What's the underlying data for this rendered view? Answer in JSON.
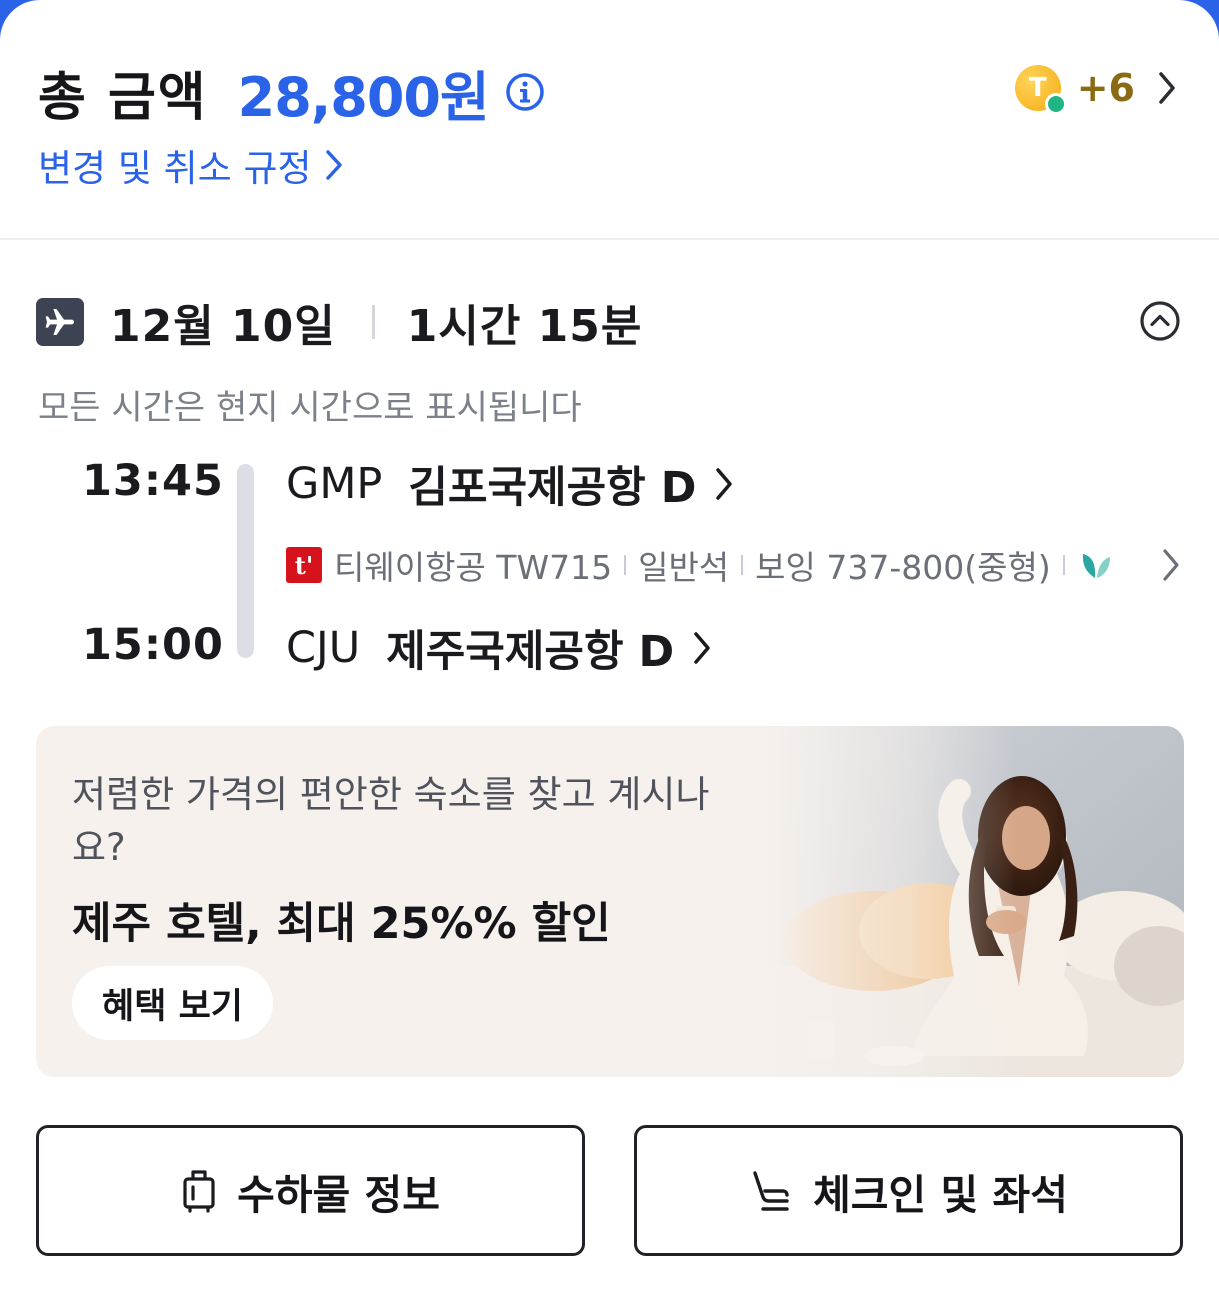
{
  "price": {
    "label": "총 금액",
    "value": "28,800원",
    "policy_link": "변경 및 취소 규정",
    "points_count": "+6",
    "coin_letter": "T"
  },
  "flight": {
    "date": "12월 10일",
    "duration": "1시간 15분",
    "local_time_note": "모든 시간은 현지 시간으로 표시됩니다",
    "departure": {
      "time": "13:45",
      "code": "GMP",
      "airport": "김포국제공항 D"
    },
    "arrival": {
      "time": "15:00",
      "code": "CJU",
      "airport": "제주국제공항 D"
    },
    "carrier": {
      "logo_text": "t'",
      "airline_flight": "티웨이항공 TW715",
      "cabin": "일반석",
      "aircraft": "보잉 737-800(중형)"
    }
  },
  "promo": {
    "question": "저렴한 가격의 편안한 숙소를 찾고 계시나요?",
    "headline": "제주 호텔, 최대 25%% 할인",
    "button": "혜택 보기"
  },
  "actions": {
    "baggage": "수하물 정보",
    "checkin": "체크인 및 좌석"
  },
  "colors": {
    "accent": "#2a63e8",
    "points_text": "#8a6a12",
    "airline_logo": "#d6131c",
    "promo_bg": "#f6f1ed"
  },
  "icons": [
    "info-icon",
    "chevron-right-icon",
    "coin-icon",
    "plane-icon",
    "chevron-up-circle-icon",
    "leaf-icon",
    "luggage-icon",
    "seat-icon"
  ]
}
